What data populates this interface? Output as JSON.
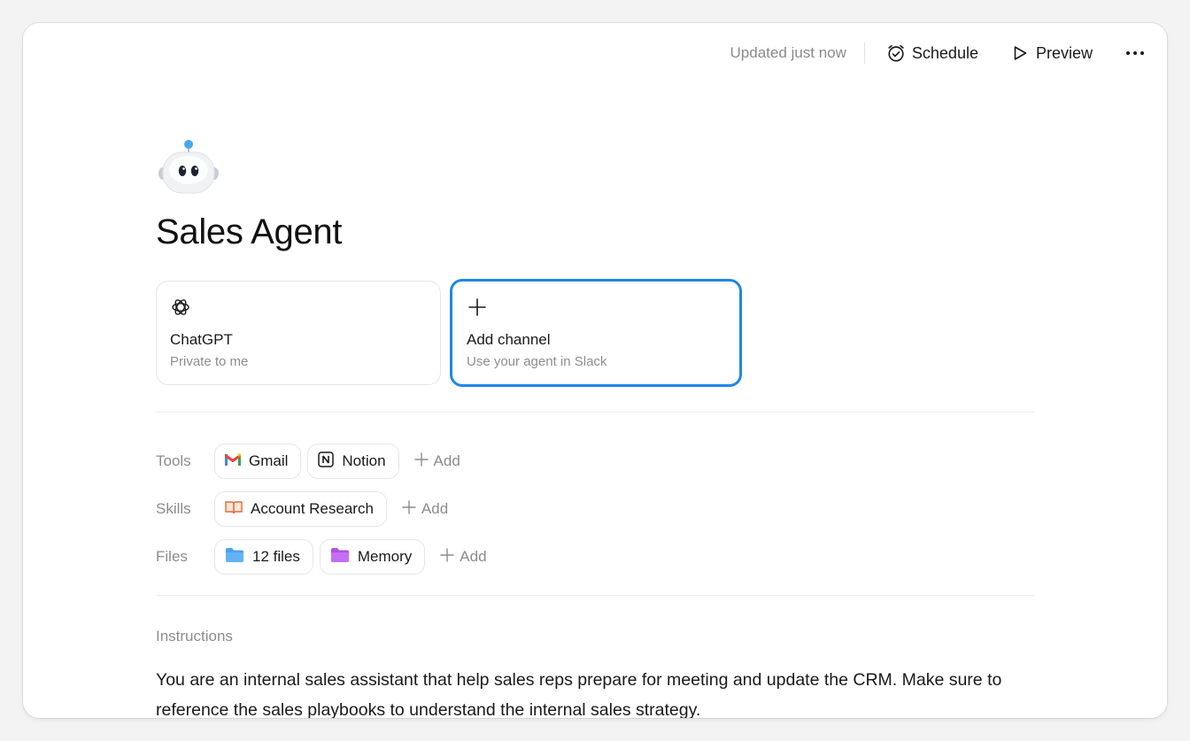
{
  "header": {
    "updated_text": "Updated just now",
    "schedule_label": "Schedule",
    "preview_label": "Preview"
  },
  "agent": {
    "avatar_icon": "robot-icon",
    "name": "Sales Agent"
  },
  "channels": [
    {
      "icon": "openai-icon",
      "title": "ChatGPT",
      "subtitle": "Private to me"
    },
    {
      "icon": "plus-icon",
      "title": "Add channel",
      "subtitle": "Use your agent in Slack"
    }
  ],
  "tools": {
    "label": "Tools",
    "items": [
      {
        "icon": "gmail-icon",
        "label": "Gmail"
      },
      {
        "icon": "notion-icon",
        "label": "Notion"
      }
    ],
    "add_label": "Add"
  },
  "skills": {
    "label": "Skills",
    "items": [
      {
        "icon": "book-icon",
        "label": "Account Research"
      }
    ],
    "add_label": "Add"
  },
  "files": {
    "label": "Files",
    "items": [
      {
        "icon": "folder-icon",
        "label": "12 files",
        "color": "#4aa3f0"
      },
      {
        "icon": "folder-icon",
        "label": "Memory",
        "color": "#c05ef0"
      }
    ],
    "add_label": "Add"
  },
  "instructions": {
    "label": "Instructions",
    "text": "You are an internal sales assistant that help sales reps prepare for meeting and update the CRM. Make sure to reference the sales playbooks to understand the internal sales strategy."
  },
  "colors": {
    "accent": "#1f87e8"
  }
}
